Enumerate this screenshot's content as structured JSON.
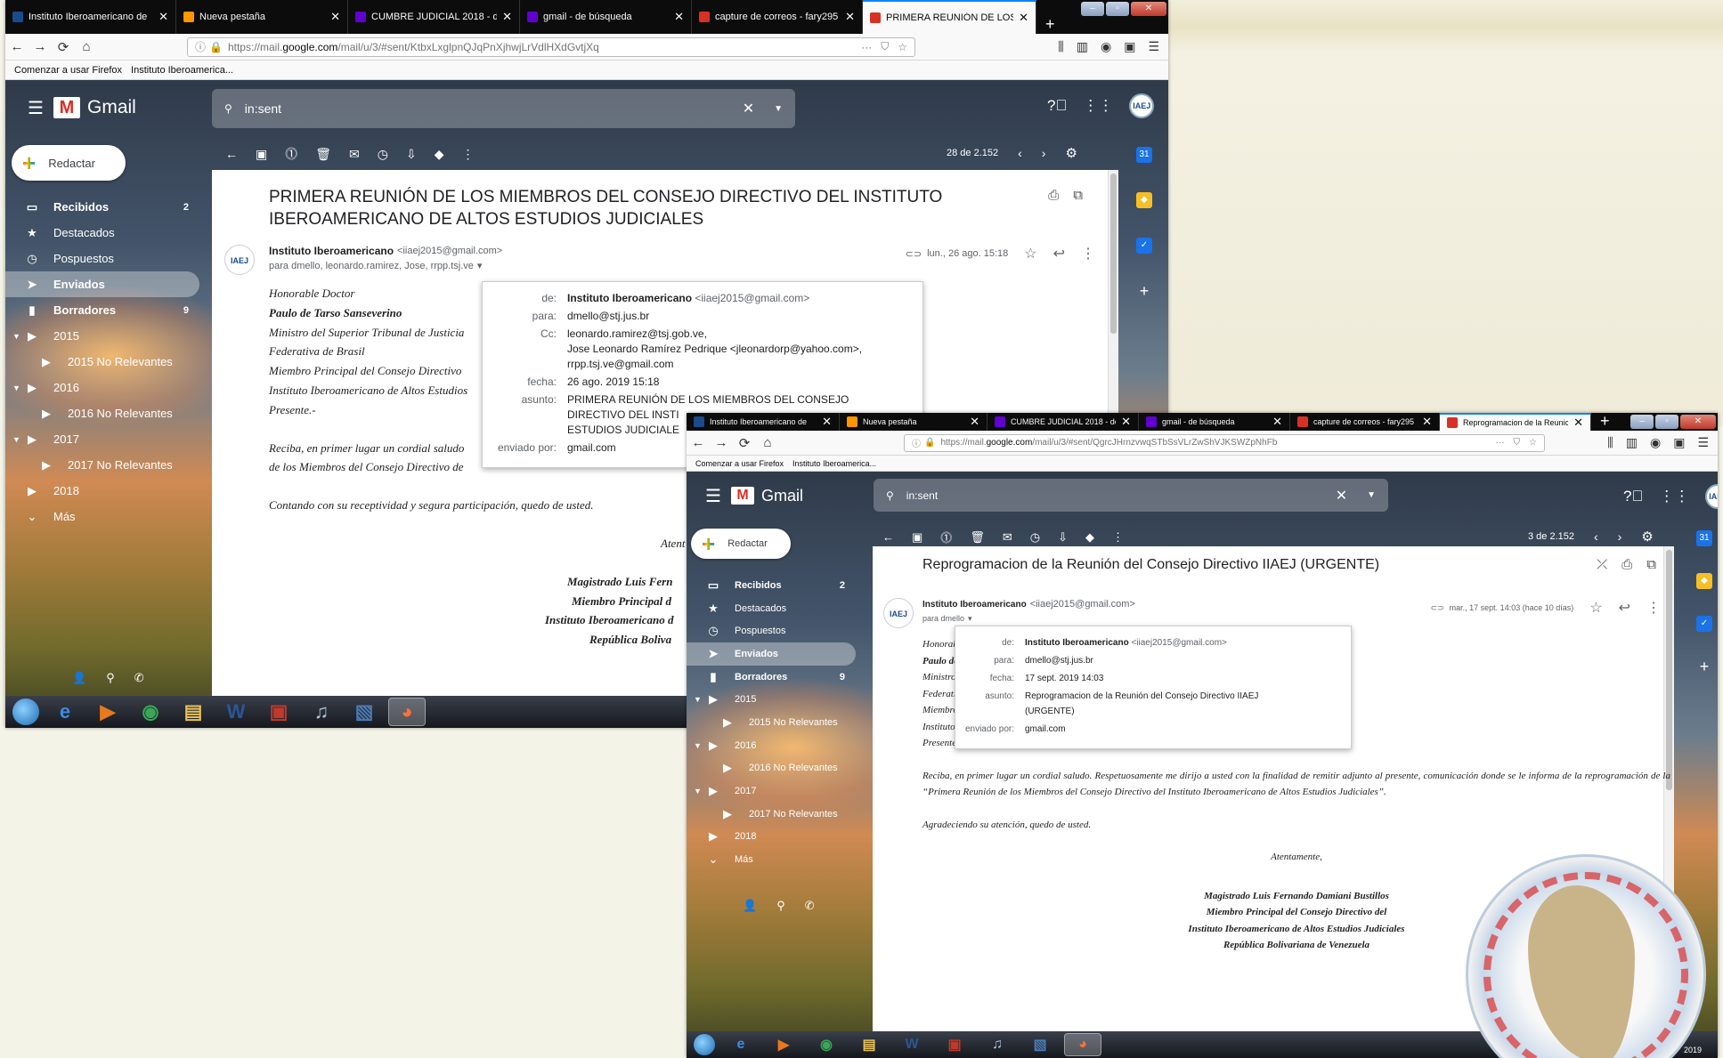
{
  "windows": [
    {
      "tabs": [
        {
          "label": "Instituto Iberoamericano de",
          "favicon": "iaej",
          "color": "#1a4b8c"
        },
        {
          "label": "Nueva pestaña",
          "favicon": "firefox",
          "color": "#ff9500"
        },
        {
          "label": "CUMBRE JUDICIAL 2018 - de",
          "favicon": "Y",
          "color": "#6001d2"
        },
        {
          "label": "gmail - de búsqueda",
          "favicon": "Y",
          "color": "#6001d2"
        },
        {
          "label": "capture de correos - fary295",
          "favicon": "M",
          "color": "#d93025"
        },
        {
          "label": "PRIMERA REUNIÓN DE LOS",
          "favicon": "M",
          "color": "#d93025",
          "active": true
        }
      ],
      "url": {
        "pre": "https://mail.",
        "domain": "google.com",
        "post": "/mail/u/3/#sent/KtbxLxglpnQJqPnXjhwjLrVdlHXdGvtjXq"
      },
      "bookmarks": [
        "Comenzar a usar Firefox",
        "Instituto Iberoamerica..."
      ],
      "gmail": {
        "app_name": "Gmail",
        "search_query": "in:sent",
        "compose_label": "Redactar",
        "pager": "28 de 2.152",
        "sidebar": [
          {
            "label": "Recibidos",
            "icon": "inbox-icon",
            "count": "2",
            "bold": true
          },
          {
            "label": "Destacados",
            "icon": "star-icon"
          },
          {
            "label": "Pospuestos",
            "icon": "clock-icon"
          },
          {
            "label": "Enviados",
            "icon": "send-icon",
            "selected": true
          },
          {
            "label": "Borradores",
            "icon": "draft-icon",
            "count": "9",
            "bold": true
          },
          {
            "label": "2015",
            "icon": "label-icon",
            "expand": true
          },
          {
            "label": "2015 No Relevantes",
            "icon": "label-icon",
            "sub": true
          },
          {
            "label": "2016",
            "icon": "label-icon",
            "expand": true
          },
          {
            "label": "2016 No Relevantes",
            "icon": "label-icon",
            "sub": true
          },
          {
            "label": "2017",
            "icon": "label-icon",
            "expand": true
          },
          {
            "label": "2017 No Relevantes",
            "icon": "label-icon",
            "sub": true
          },
          {
            "label": "2018",
            "icon": "label-icon"
          },
          {
            "label": "Más",
            "icon": "chevron-down-icon"
          }
        ],
        "email": {
          "subject": "PRIMERA REUNIÓN DE LOS MIEMBROS DEL CONSEJO DIRECTIVO DEL INSTITUTO IBEROAMERICANO DE ALTOS ESTUDIOS JUDICIALES",
          "sender_name": "Instituto Iberoamericano",
          "sender_addr": "<iiaej2015@gmail.com>",
          "to_line": "para dmello, leonardo.ramirez, Jose, rrpp.tsj.ve",
          "date": "lun., 26 ago. 15:18",
          "body": [
            "Honorable Doctor",
            "Paulo de Tarso Sanseverino",
            "Ministro del Superior Tribunal de Justicia",
            "Federativa de Brasil",
            "Miembro Principal del Consejo Directivo",
            "Instituto Iberoamericano de Altos Estudios",
            "Presente.-",
            "Reciba, en primer lugar un cordial saludo",
            "de los Miembros del Consejo Directivo de",
            "Contando con su receptividad y segura participación, quedo de usted.",
            "Atent",
            "Magistrado  Luis Fern",
            "Miembro Principal d",
            "Instituto Iberoamericano d",
            "República Boliva"
          ],
          "details": [
            {
              "k": "de:",
              "v": "Instituto Iberoamericano",
              "v2": " <iiaej2015@gmail.com>"
            },
            {
              "k": "para:",
              "v": "dmello@stj.jus.br"
            },
            {
              "k": "Cc:",
              "v": "leonardo.ramirez@tsj.gob.ve,\nJose Leonardo Ramírez Pedrique <jleonardorp@yahoo.com>,\nrrpp.tsj.ve@gmail.com"
            },
            {
              "k": "fecha:",
              "v": "26 ago. 2019 15:18"
            },
            {
              "k": "asunto:",
              "v": "PRIMERA REUNIÓN DE LOS MIEMBROS DEL CONSEJO\nDIRECTIVO DEL INSTI\nESTUDIOS JUDICIALE"
            },
            {
              "k": "enviado por:",
              "v": "gmail.com"
            }
          ]
        }
      }
    },
    {
      "tabs": [
        {
          "label": "Instituto Iberoamericano de",
          "favicon": "iaej",
          "color": "#1a4b8c"
        },
        {
          "label": "Nueva pestaña",
          "favicon": "firefox",
          "color": "#ff9500"
        },
        {
          "label": "CUMBRE JUDICIAL 2018 - de",
          "favicon": "Y",
          "color": "#6001d2"
        },
        {
          "label": "gmail - de búsqueda",
          "favicon": "Y",
          "color": "#6001d2"
        },
        {
          "label": "capture de correos - fary295",
          "favicon": "M",
          "color": "#d93025"
        },
        {
          "label": "Reprogramacion de la Reunic",
          "favicon": "M",
          "color": "#d93025",
          "active": true
        }
      ],
      "url": {
        "pre": "https://mail.",
        "domain": "google.com",
        "post": "/mail/u/3/#sent/QgrcJHrnzvwqSTbSsVLrZwShVJKSWZpNhFb"
      },
      "bookmarks": [
        "Comenzar a usar Firefox",
        "Instituto Iberoamerica..."
      ],
      "gmail": {
        "app_name": "Gmail",
        "search_query": "in:sent",
        "compose_label": "Redactar",
        "pager": "3 de 2.152",
        "sidebar": [
          {
            "label": "Recibidos",
            "icon": "inbox-icon",
            "count": "2",
            "bold": true
          },
          {
            "label": "Destacados",
            "icon": "star-icon"
          },
          {
            "label": "Pospuestos",
            "icon": "clock-icon"
          },
          {
            "label": "Enviados",
            "icon": "send-icon",
            "selected": true
          },
          {
            "label": "Borradores",
            "icon": "draft-icon",
            "count": "9",
            "bold": true
          },
          {
            "label": "2015",
            "icon": "label-icon",
            "expand": true
          },
          {
            "label": "2015 No Relevantes",
            "icon": "label-icon",
            "sub": true
          },
          {
            "label": "2016",
            "icon": "label-icon",
            "expand": true
          },
          {
            "label": "2016 No Relevantes",
            "icon": "label-icon",
            "sub": true
          },
          {
            "label": "2017",
            "icon": "label-icon",
            "expand": true
          },
          {
            "label": "2017 No Relevantes",
            "icon": "label-icon",
            "sub": true
          },
          {
            "label": "2018",
            "icon": "label-icon"
          },
          {
            "label": "Más",
            "icon": "chevron-down-icon"
          }
        ],
        "email": {
          "subject": "Reprogramacion de la Reunión del Consejo Directivo IIAEJ (URGENTE)",
          "sender_name": "Instituto Iberoamericano",
          "sender_addr": "<iiaej2015@gmail.com>",
          "to_line": "para dmello",
          "date": "mar., 17 sept. 14:03 (hace 10 días)",
          "body": [
            "Honorable",
            "Paulo de T",
            "Ministro de",
            "Federativa",
            "Miembro P",
            "Instituto Ib",
            "Presente.-",
            "Reciba, en primer lugar un cordial saludo. Respetuosamente me dirijo a usted con la finalidad de remitir adjunto al presente, comunicación donde se le informa de la reprogramación de la “Primera Reunión de los Miembros del Consejo Directivo del Instituto Iberoamericano de Altos Estudios Judiciales”.",
            "Agradeciendo su atención, quedo de usted.",
            "Atentamente,",
            "Magistrado  Luis Fernando Damiani Bustillos",
            "Miembro Principal del Consejo Directivo del",
            "Instituto Iberoamericano de Altos Estudios Judiciales",
            "República Bolivariana de Venezuela"
          ],
          "details": [
            {
              "k": "de:",
              "v": "Instituto Iberoamericano",
              "v2": " <iiaej2015@gmail.com>"
            },
            {
              "k": "para:",
              "v": "dmello@stj.jus.br"
            },
            {
              "k": "fecha:",
              "v": "17 sept. 2019 14:03"
            },
            {
              "k": "asunto:",
              "v": "Reprogramacion de la Reunión del Consejo Directivo IIAEJ\n(URGENTE)"
            },
            {
              "k": "enviado por:",
              "v": "gmail.com"
            }
          ]
        }
      }
    }
  ],
  "taskbar": {
    "apps": [
      {
        "name": "internet-explorer",
        "glyph": "e",
        "color": "#3b8be0"
      },
      {
        "name": "media-player",
        "glyph": "▶",
        "color": "#e8791c"
      },
      {
        "name": "chrome",
        "glyph": "◉",
        "color": "#3aa757"
      },
      {
        "name": "file-explorer",
        "glyph": "▤",
        "color": "#e8c25a"
      },
      {
        "name": "word",
        "glyph": "W",
        "color": "#2b5797"
      },
      {
        "name": "pdf-reader",
        "glyph": "▣",
        "color": "#c0392b"
      },
      {
        "name": "itunes",
        "glyph": "♫",
        "color": "#b0c4de"
      },
      {
        "name": "photo-viewer",
        "glyph": "▧",
        "color": "#4a7ab0"
      },
      {
        "name": "firefox",
        "glyph": "◕",
        "color": "#ff7139",
        "active": true
      }
    ],
    "clock_fragment": "2019"
  },
  "rail_icons": [
    {
      "name": "calendar-icon",
      "glyph": "31",
      "color": "#1a73e8"
    },
    {
      "name": "keep-icon",
      "glyph": "◆",
      "color": "#f6bf26"
    },
    {
      "name": "tasks-icon",
      "glyph": "✓",
      "color": "#1a73e8"
    },
    {
      "name": "add-addon-icon",
      "glyph": "+",
      "color": "transparent"
    }
  ]
}
